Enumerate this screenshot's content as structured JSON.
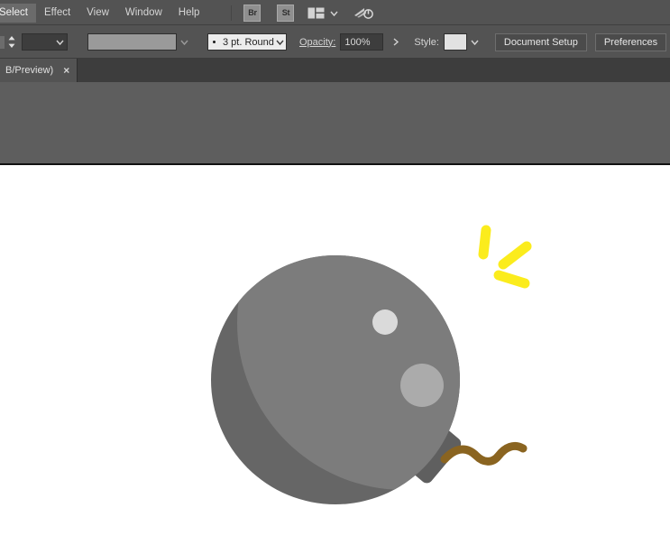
{
  "menubar": {
    "items": [
      {
        "label": "Select",
        "active": true,
        "clipped": true
      },
      {
        "label": "Effect",
        "active": false
      },
      {
        "label": "View",
        "active": false
      },
      {
        "label": "Window",
        "active": false
      },
      {
        "label": "Help",
        "active": false
      }
    ],
    "bridge_label": "Br",
    "stock_label": "St",
    "arrange_icon": "arrange-documents-icon",
    "arrange_chevron_icon": "chevron-down-icon",
    "sync_icon": "sync-settings-icon"
  },
  "controlbar": {
    "stroke_weight_stepper_icon": "stepper-up-down-icon",
    "stroke_weight_value": "",
    "stroke_weight_arrow_icon": "chevron-down-icon",
    "stroke_profile_value": "",
    "stroke_profile_arrow_icon": "chevron-down-icon",
    "brush_bullet_icon": "brush-stroke-dot-icon",
    "brush_definition_value": "3 pt. Round",
    "brush_arrow_icon": "chevron-down-icon",
    "opacity_label": "Opacity:",
    "opacity_value": "100%",
    "more_options_icon": "chevron-right-icon",
    "style_label": "Style:",
    "style_swatch_color": "#e2e2e2",
    "style_arrow_icon": "chevron-down-icon",
    "document_setup_label": "Document Setup",
    "preferences_label": "Preferences",
    "select_similar_icon": "select-similar-objects-icon",
    "select_similar_chevron_icon": "chevron-down-icon"
  },
  "tabbar": {
    "document_tab_label": "B/Preview)",
    "document_tab_close_label": "×"
  },
  "canvas": {
    "background_color": "#ffffff",
    "artwork_name": "bomb-illustration",
    "colors": {
      "body_dark": "#666666",
      "body_light": "#7c7c7c",
      "cap": "#5f5f5f",
      "highlight_small": "#dadada",
      "highlight_large": "#ababab",
      "fuse": "#8a6420",
      "spark": "#fbec1d"
    }
  }
}
